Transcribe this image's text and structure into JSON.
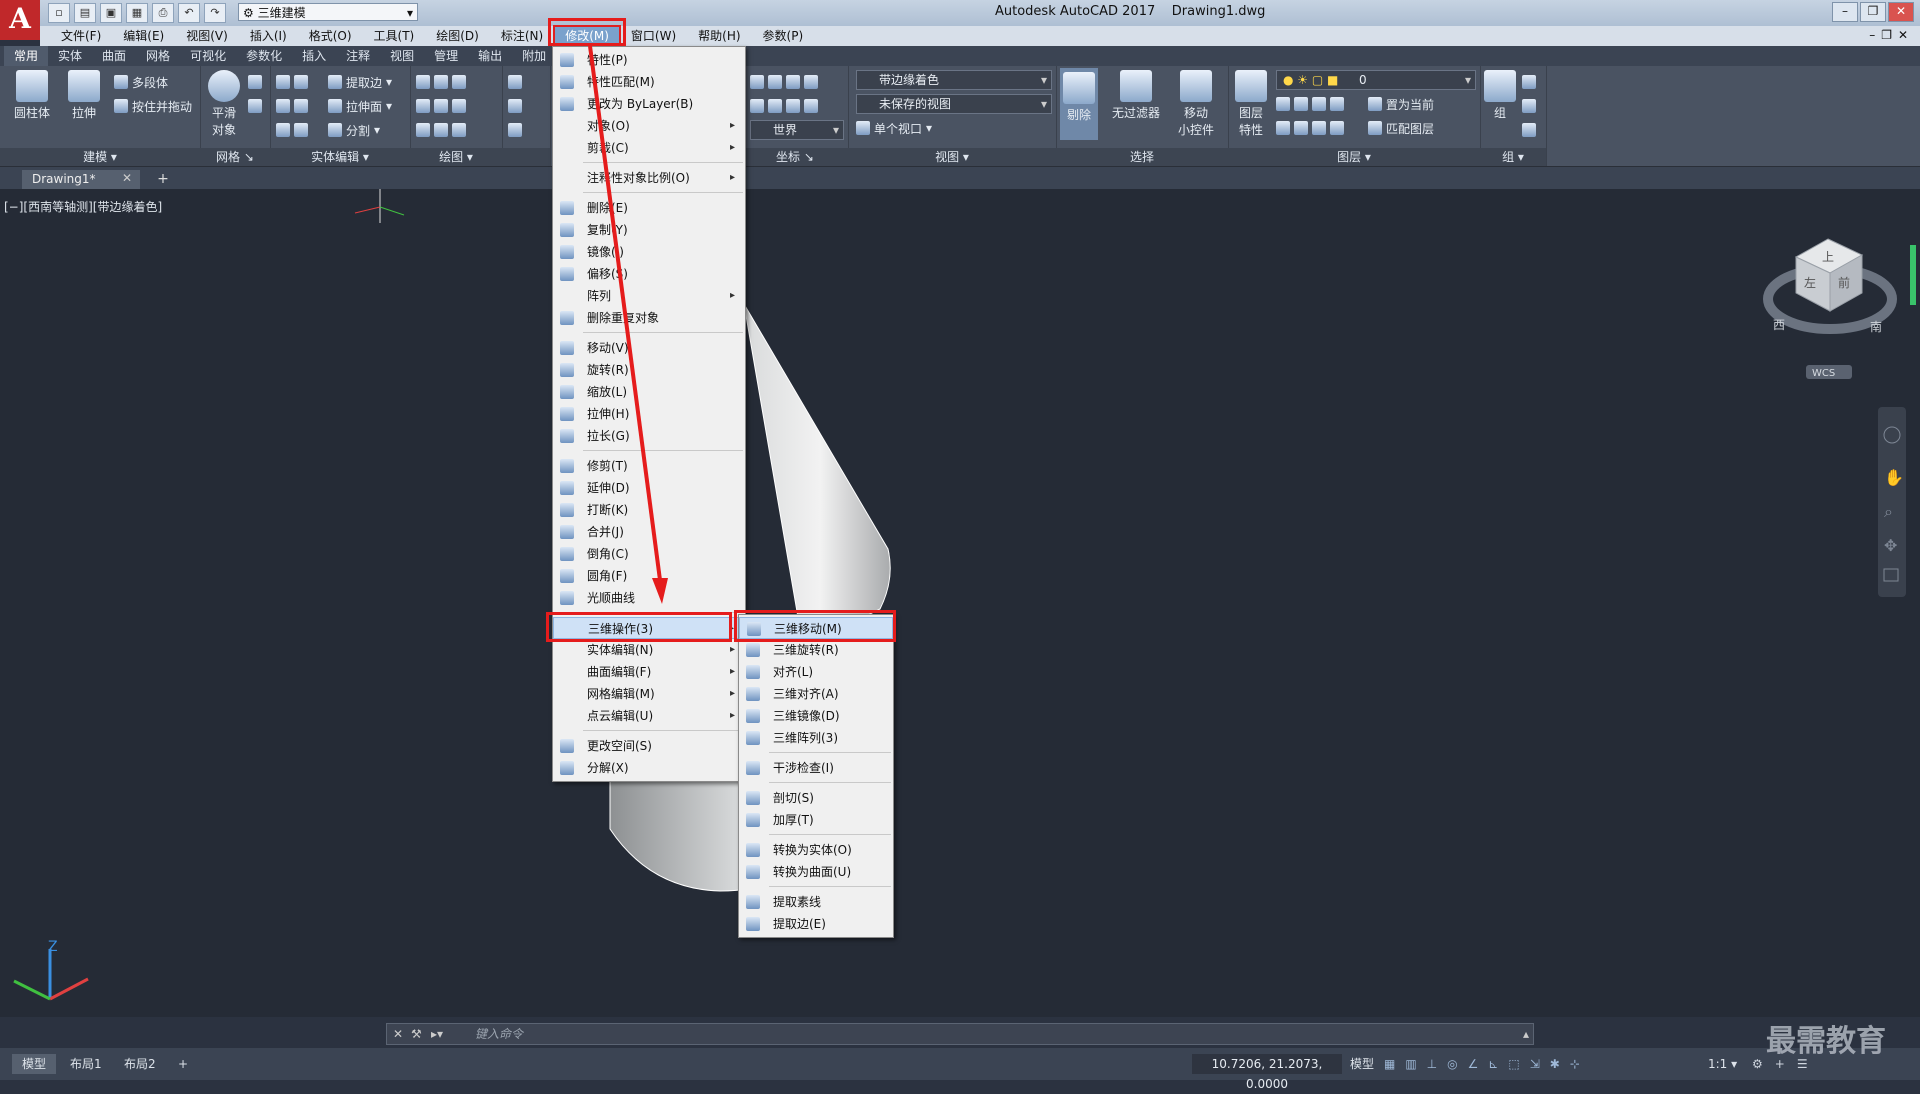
{
  "titlebar": {
    "workspace": "三维建模",
    "title": "Autodesk AutoCAD 2017    Drawing1.dwg"
  },
  "menubar": {
    "items": [
      "文件(F)",
      "编辑(E)",
      "视图(V)",
      "插入(I)",
      "格式(O)",
      "工具(T)",
      "绘图(D)",
      "标注(N)",
      "修改(M)",
      "窗口(W)",
      "帮助(H)",
      "参数(P)"
    ],
    "active": "修改(M)"
  },
  "ribbon_tabs": [
    "常用",
    "实体",
    "曲面",
    "网格",
    "可视化",
    "参数化",
    "插入",
    "注释",
    "视图",
    "管理",
    "输出",
    "附加"
  ],
  "ribbon": {
    "cylinder": "圆柱体",
    "extrude": "拉伸",
    "polysolid": "多段体",
    "presspull": "按住并拖动",
    "model_panel": "建模",
    "smooth1": "平滑",
    "smooth2": "对象",
    "mesh_panel": "网格",
    "extract_edges": "提取边",
    "extrude_face": "拉伸面",
    "separate": "分割",
    "solid_edit_panel": "实体编辑",
    "draw_panel": "绘图",
    "coord_panel": "坐标",
    "visual_style": "带边缘着色",
    "saved_view": "未保存的视图",
    "world": "世界",
    "single_viewport": "单个视口",
    "view_panel": "视图",
    "cull": "剔除",
    "no_filter": "无过滤器",
    "move_gizmo1": "移动",
    "move_gizmo2": "小控件",
    "select_panel": "选择",
    "layer_props1": "图层",
    "layer_props2": "特性",
    "layer_name": "0",
    "set_current": "置为当前",
    "match_layer": "匹配图层",
    "layer_panel": "图层",
    "group": "组",
    "group_panel": "组"
  },
  "doc_tab": "Drawing1*",
  "view_label": "[−][西南等轴测][带边缘着色]",
  "modify_menu": [
    {
      "label": "特性(P)",
      "sub": false
    },
    {
      "label": "特性匹配(M)",
      "sub": false
    },
    {
      "label": "更改为 ByLayer(B)",
      "sub": false
    },
    {
      "label": "对象(O)",
      "sub": true
    },
    {
      "label": "剪裁(C)",
      "sub": true
    },
    {
      "label": "注释性对象比例(O)",
      "sub": true
    },
    {
      "label": "删除(E)",
      "sub": false
    },
    {
      "label": "复制(Y)",
      "sub": false
    },
    {
      "label": "镜像(I)",
      "sub": false
    },
    {
      "label": "偏移(S)",
      "sub": false
    },
    {
      "label": "阵列",
      "sub": true
    },
    {
      "label": "删除重复对象",
      "sub": false
    },
    {
      "label": "移动(V)",
      "sub": false
    },
    {
      "label": "旋转(R)",
      "sub": false
    },
    {
      "label": "缩放(L)",
      "sub": false
    },
    {
      "label": "拉伸(H)",
      "sub": false
    },
    {
      "label": "拉长(G)",
      "sub": false
    },
    {
      "label": "修剪(T)",
      "sub": false
    },
    {
      "label": "延伸(D)",
      "sub": false
    },
    {
      "label": "打断(K)",
      "sub": false
    },
    {
      "label": "合并(J)",
      "sub": false
    },
    {
      "label": "倒角(C)",
      "sub": false
    },
    {
      "label": "圆角(F)",
      "sub": false
    },
    {
      "label": "光顺曲线",
      "sub": false
    },
    {
      "label": "三维操作(3)",
      "sub": true
    },
    {
      "label": "实体编辑(N)",
      "sub": true
    },
    {
      "label": "曲面编辑(F)",
      "sub": true
    },
    {
      "label": "网格编辑(M)",
      "sub": true
    },
    {
      "label": "点云编辑(U)",
      "sub": true
    },
    {
      "label": "更改空间(S)",
      "sub": false
    },
    {
      "label": "分解(X)",
      "sub": false
    }
  ],
  "submenu_3d": [
    "三维移动(M)",
    "三维旋转(R)",
    "对齐(L)",
    "三维对齐(A)",
    "三维镜像(D)",
    "三维阵列(3)",
    "干涉检查(I)",
    "剖切(S)",
    "加厚(T)",
    "转换为实体(O)",
    "转换为曲面(U)",
    "提取素线",
    "提取边(E)"
  ],
  "viewcube": {
    "top": "上",
    "left": "左",
    "front": "前",
    "west": "西",
    "south": "南",
    "wcs": "WCS"
  },
  "command": {
    "placeholder": "键入命令"
  },
  "layout_tabs": [
    "模型",
    "布局1",
    "布局2"
  ],
  "status": {
    "coords": "10.7206, 21.2073, 0.0000",
    "model": "模型",
    "scale": "1:1"
  },
  "watermark": "最需教育",
  "colors": {
    "highlight": "#e51c1c",
    "canvas": "#252b36"
  }
}
